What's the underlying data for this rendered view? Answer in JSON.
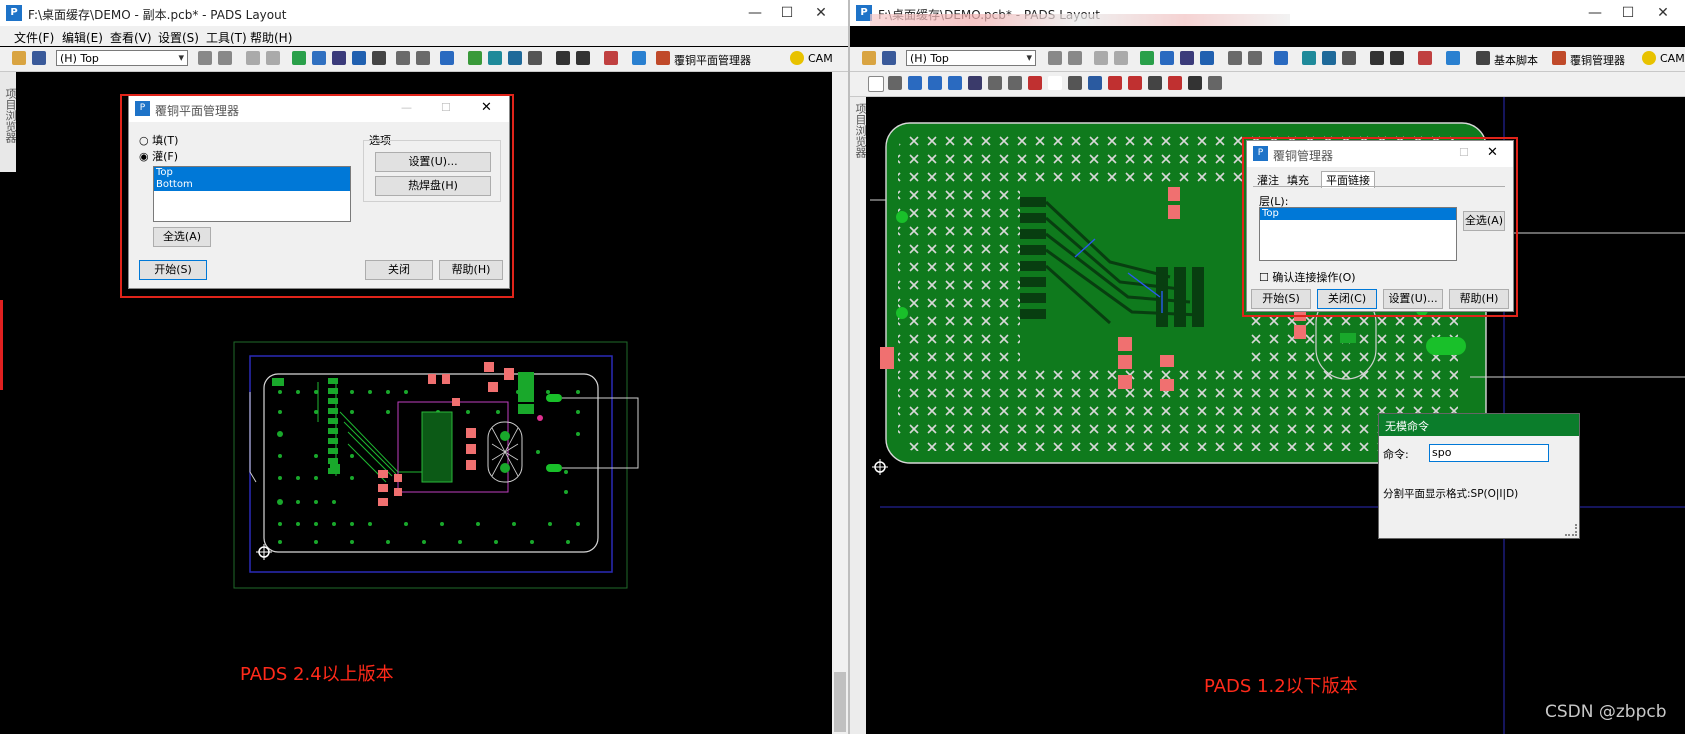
{
  "left": {
    "title": "F:\\桌面缓存\\DEMO - 副本.pcb* - PADS Layout",
    "menu": [
      "文件(F)",
      "编辑(E)",
      "查看(V)",
      "设置(S)",
      "工具(T)",
      "帮助(H)"
    ],
    "layer": "(H) Top",
    "toolbar_text": "覆铜平面管理器",
    "cam": "CAM",
    "side_label": "项目浏览器",
    "caption": "PADS 2.4以上版本",
    "dialog": {
      "title": "覆铜平面管理器",
      "radio_fill": "填(T)",
      "radio_flood": "灌(F)",
      "list_items": [
        "Top",
        "Bottom"
      ],
      "select_all": "全选(A)",
      "options_label": "选项",
      "setup": "设置(U)...",
      "thermal": "热焊盘(H)",
      "start": "开始(S)",
      "close": "关闭",
      "help": "帮助(H)"
    }
  },
  "right": {
    "title": "F:\\桌面缓存\\DEMO.pcb* - PADS Layout",
    "layer": "(H) Top",
    "basic_script": "基本脚本",
    "pour_manager": "覆铜管理器",
    "cam": "CAM",
    "side_label": "项目浏览器",
    "caption": "PADS 1.2以下版本",
    "dialog": {
      "title": "覆铜管理器",
      "tabs": [
        "灌注",
        "填充",
        "平面链接"
      ],
      "layer_label": "层(L):",
      "list_items": [
        "Top"
      ],
      "select_all": "全选(A)",
      "confirm": "确认连接操作(O)",
      "start": "开始(S)",
      "close": "关闭(C)",
      "setup": "设置(U)...",
      "help": "帮助(H)"
    },
    "modeless": {
      "title": "无模命令",
      "cmd_label": "命令:",
      "cmd_value": "spo",
      "hint": "分割平面显示格式:SP(O|I|D)"
    }
  },
  "watermark": "CSDN @zbpcb",
  "colors": {
    "board_green": "#0f7a1d",
    "pad_pink": "#f07070",
    "dialog_highlight": "#e0241a",
    "selection_blue": "#0078d7",
    "modeless_header": "#0b7d2b"
  }
}
